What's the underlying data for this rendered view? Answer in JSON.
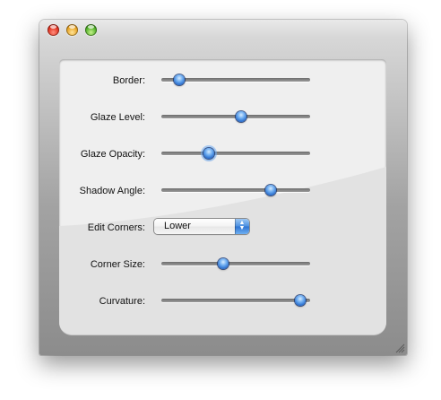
{
  "window": {
    "controls": [
      "close-icon",
      "minimize-icon",
      "zoom-icon"
    ]
  },
  "settings": {
    "border": {
      "label": "Border:",
      "value": 0.06
    },
    "glaze_level": {
      "label": "Glaze Level:",
      "value": 0.54
    },
    "glaze_opacity": {
      "label": "Glaze Opacity:",
      "value": 0.29
    },
    "shadow_angle": {
      "label": "Shadow Angle:",
      "value": 0.77
    },
    "edit_corners": {
      "label": "Edit Corners:",
      "selected": "Lower"
    },
    "corner_size": {
      "label": "Corner Size:",
      "value": 0.4
    },
    "curvature": {
      "label": "Curvature:",
      "value": 1.0
    }
  },
  "colors": {
    "accent": "#2d73d2",
    "panel": "#efefef"
  }
}
